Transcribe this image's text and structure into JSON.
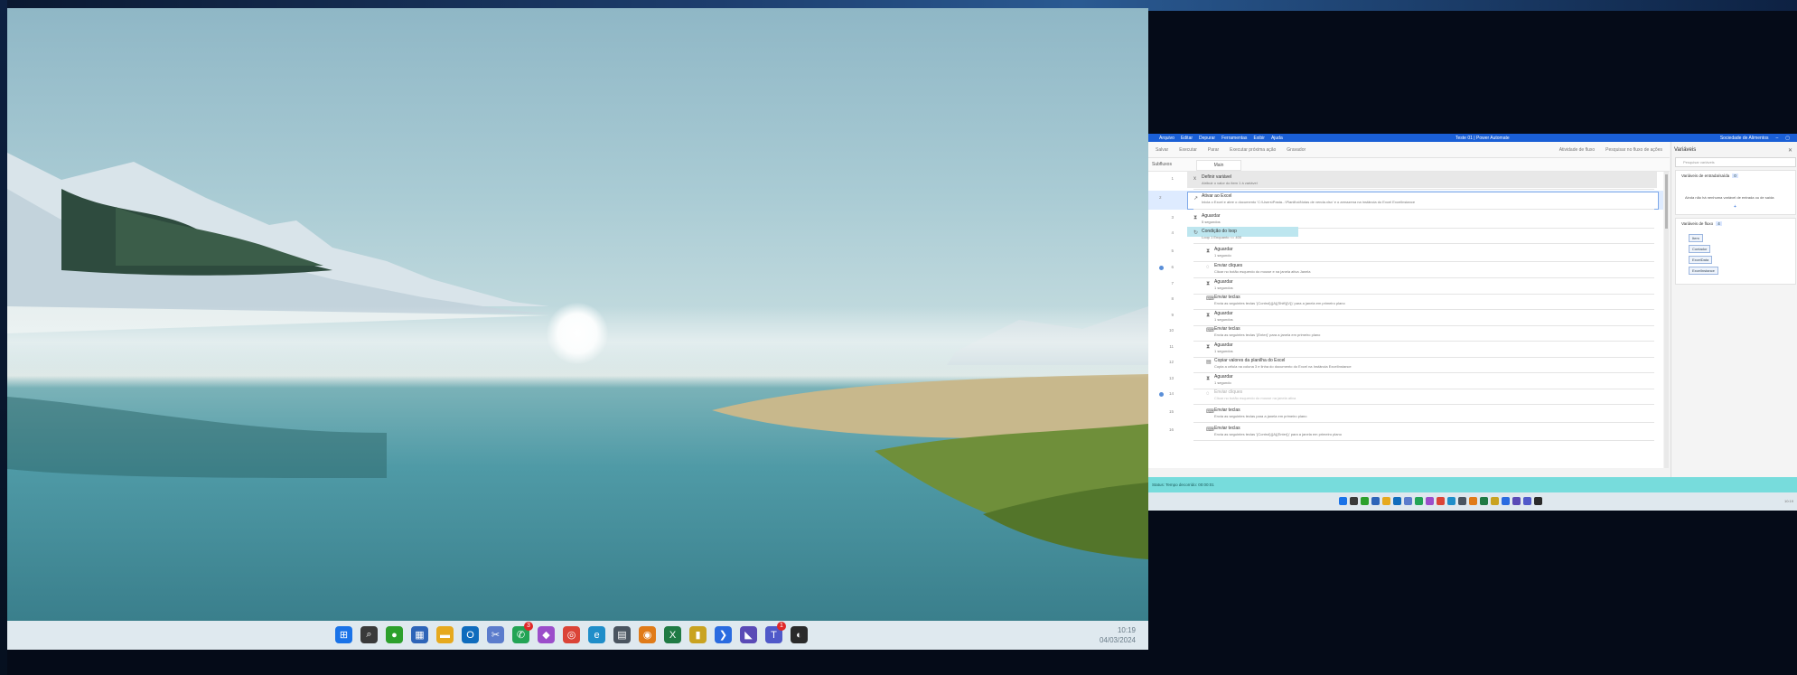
{
  "desktop": {
    "clock_time": "10:19",
    "clock_date": "04/03/2024",
    "taskbar_icons": [
      {
        "name": "windows-start-icon",
        "color": "#1a73e8",
        "glyph": "⊞"
      },
      {
        "name": "search-icon",
        "color": "#3a3a3a",
        "glyph": "⌕"
      },
      {
        "name": "xbox-icon",
        "color": "#2ca02c",
        "glyph": "●"
      },
      {
        "name": "calendar-icon",
        "color": "#2d64b8",
        "glyph": "▦"
      },
      {
        "name": "file-explorer-icon",
        "color": "#e6a91e",
        "glyph": "▬"
      },
      {
        "name": "outlook-icon",
        "color": "#0f6cbd",
        "glyph": "O"
      },
      {
        "name": "snipping-tool-icon",
        "color": "#5b7ccc",
        "glyph": "✂"
      },
      {
        "name": "whatsapp-icon",
        "color": "#23a455",
        "glyph": "✆",
        "badge": "3"
      },
      {
        "name": "power-apps-icon",
        "color": "#9b4dca",
        "glyph": "◆"
      },
      {
        "name": "chrome-icon",
        "color": "#db4437",
        "glyph": "◎"
      },
      {
        "name": "edge-icon",
        "color": "#1f8ec9",
        "glyph": "e"
      },
      {
        "name": "calculator-icon",
        "color": "#4a5560",
        "glyph": "▤"
      },
      {
        "name": "podcast-icon",
        "color": "#e07b18",
        "glyph": "◉"
      },
      {
        "name": "excel-icon",
        "color": "#1f7a44",
        "glyph": "X"
      },
      {
        "name": "sticky-notes-icon",
        "color": "#c9a321",
        "glyph": "▮"
      },
      {
        "name": "power-automate-icon",
        "color": "#2a6be0",
        "glyph": "❯"
      },
      {
        "name": "visual-studio-icon",
        "color": "#5a4ab6",
        "glyph": "◣"
      },
      {
        "name": "teams-icon",
        "color": "#5059c9",
        "glyph": "T",
        "badge": "1"
      },
      {
        "name": "obs-icon",
        "color": "#2a2a2a",
        "glyph": "◐"
      }
    ]
  },
  "pad": {
    "title": "Teste 01 | Power Automate",
    "menus": [
      "Arquivo",
      "Editar",
      "Depurar",
      "Ferramentas",
      "Exibir",
      "Ajuda"
    ],
    "account": "Sociedade de Alimentos",
    "toolbar_left": [
      "Salvar",
      "Executar",
      "Parar",
      "Executar próxima ação",
      "Gravador"
    ],
    "toolbar_right": [
      "Atividade de fluxo",
      "Pesquisar no fluxo de ações"
    ],
    "subflows_label": "Subfluxos",
    "main_tab": "Main",
    "status": "Status: Tempo decorrido: 00:00:01",
    "rows": [
      {
        "n": "1",
        "title": "Definir variável",
        "desc": "Atribuir o valor do item  1 à variável"
      },
      {
        "n": "2",
        "title": "Ativar ao Excel",
        "desc": "Inicia o Excel e abre o documento 'C:\\Users\\Pasta...\\Planilha\\Notas de venda.xlsx' e o armazena na instância do Excel ExcelInstance",
        "selected": true
      },
      {
        "n": "3",
        "title": "Aguardar",
        "desc": "5 segundos"
      },
      {
        "n": "4",
        "title": "Condição do loop",
        "desc": "Loop 1 Enquanto  <= 400",
        "loop": true
      },
      {
        "n": "5",
        "title": "Aguardar",
        "desc": "1 segundo"
      },
      {
        "n": "6",
        "title": "Enviar cliques",
        "desc": "Clicar no botão esquerdo do mouse e na janela ativa  Janela",
        "bp": true
      },
      {
        "n": "7",
        "title": "Aguardar",
        "desc": "1 segundos"
      },
      {
        "n": "8",
        "title": "Enviar teclas",
        "desc": "Envia as seguintes teclas '{Control}({A}{Shift}{V})' para a janela em primeiro plano"
      },
      {
        "n": "9",
        "title": "Aguardar",
        "desc": "1 segundos"
      },
      {
        "n": "10",
        "title": "Enviar teclas",
        "desc": "Envia as seguintes teclas '{Enter}' para a janela em primeiro plano"
      },
      {
        "n": "11",
        "title": "Aguardar",
        "desc": "1 segundos"
      },
      {
        "n": "12",
        "title": "Copiar valores da planilha do Excel",
        "desc": "Copia a célula na coluna 3 e linha  do documento do Excel na Instância ExcelInstance"
      },
      {
        "n": "13",
        "title": "Aguardar",
        "desc": "1 segundo"
      },
      {
        "n": "14",
        "title": "Enviar cliques",
        "desc": "Clicar no botão esquerdo do mouse na janela ativa",
        "bp": true,
        "disabled": true
      },
      {
        "n": "15",
        "title": "Enviar teclas",
        "desc": "Envia as seguintes teclas para a janela em primeiro plano"
      },
      {
        "n": "16",
        "title": "Enviar teclas",
        "desc": "Envia as seguintes teclas '{Control}({A}{Enter})' para a janela em primeiro plano"
      }
    ],
    "variables": {
      "title": "Variáveis",
      "search_placeholder": "Pesquisar variáveis",
      "input_output_label": "Variáveis de entrada/saída",
      "input_output_count": "0",
      "input_output_msg": "Ainda não há nenhuma variável de entrada ou de saída",
      "input_output_add": "+",
      "flow_label": "Variáveis de fluxo",
      "flow_count": "4",
      "flow_vars": [
        "Item",
        "Contador",
        "ExcelData",
        "ExcelInstance"
      ]
    }
  }
}
